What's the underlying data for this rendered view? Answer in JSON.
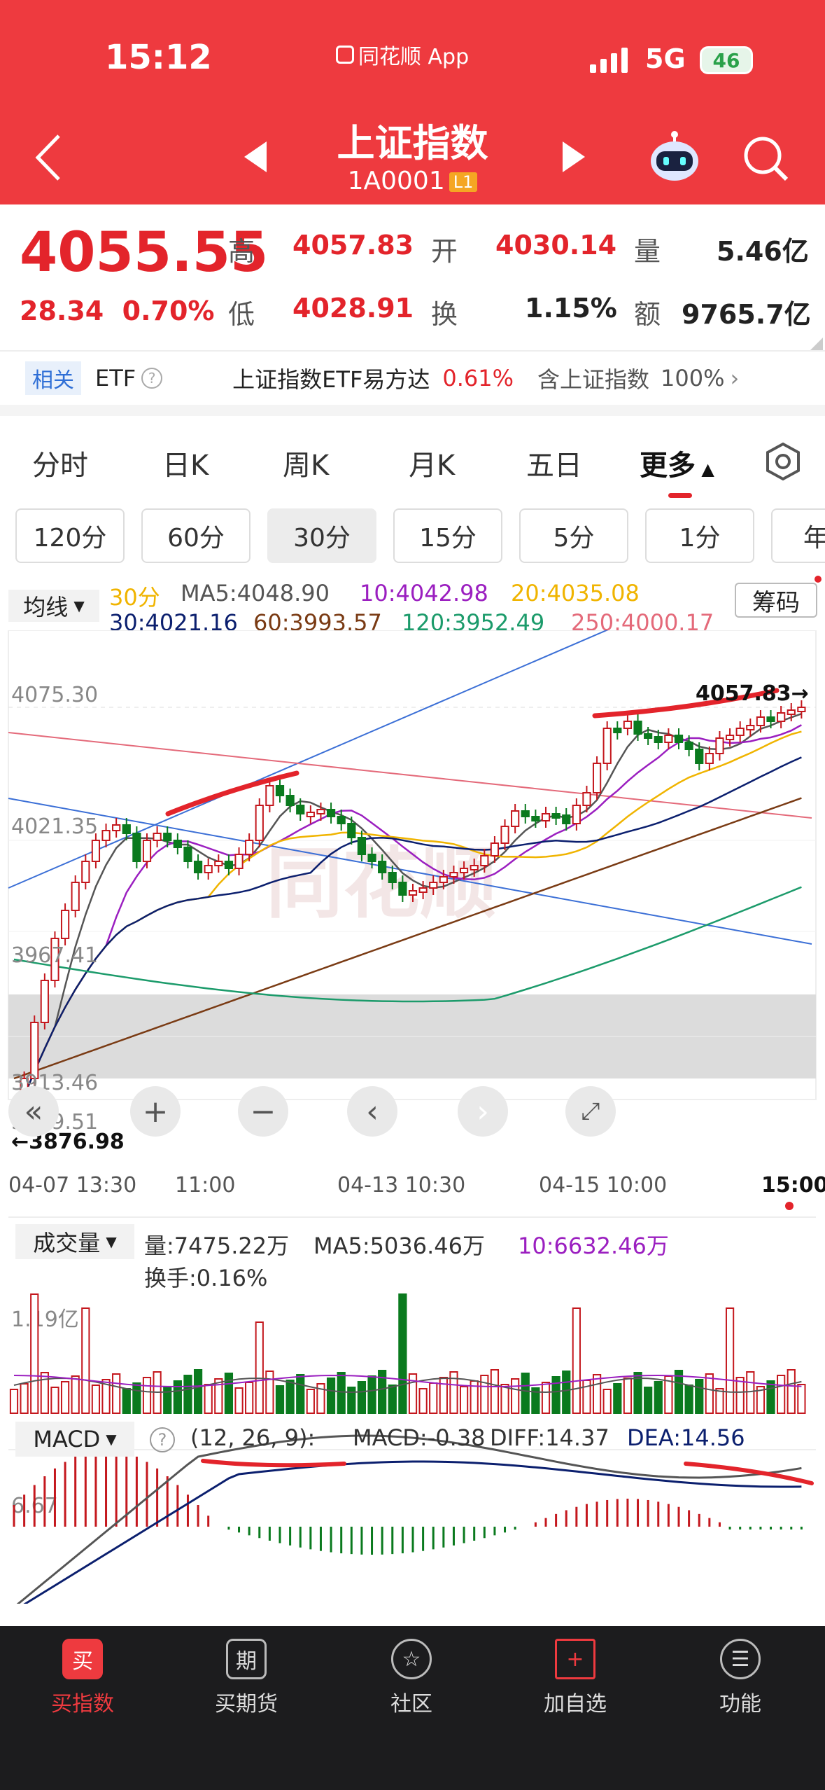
{
  "status": {
    "time": "15:12",
    "app_name": "同花顺 App",
    "network": "5G",
    "battery": "46"
  },
  "header": {
    "title": "上证指数",
    "code": "1A0001",
    "level": "L1"
  },
  "quote": {
    "price": "4055.55",
    "change": "28.34",
    "change_pct": "0.70%",
    "high_label": "高",
    "high": "4057.83",
    "low_label": "低",
    "low": "4028.91",
    "open_label": "开",
    "open": "4030.14",
    "turnover_label": "换",
    "turnover": "1.15%",
    "volume_label": "量",
    "volume": "5.46亿",
    "amount_label": "额",
    "amount": "9765.7亿"
  },
  "etf": {
    "tag": "相关",
    "label": "ETF",
    "name": "上证指数ETF易方达",
    "change": "0.61%",
    "contain": "含上证指数",
    "weight": "100%"
  },
  "tabs": [
    "分时",
    "日K",
    "周K",
    "月K",
    "五日",
    "更多"
  ],
  "periods": [
    "120分",
    "60分",
    "30分",
    "15分",
    "5分",
    "1分",
    "年"
  ],
  "chart": {
    "ma_button": "均线",
    "chips_button": "筹码",
    "period": "30分",
    "ma5": "MA5:4048.90",
    "ma10": "10:4042.98",
    "ma20": "20:4035.08",
    "ma30": "30:4021.16",
    "ma60": "60:3993.57",
    "ma120": "120:3952.49",
    "ma250": "250:4000.17",
    "y_labels": [
      "4075.30",
      "4021.35",
      "3967.41",
      "3913.46",
      "3859.51"
    ],
    "high_marker": "4057.83→",
    "low_marker": "←3876.98",
    "x_labels": [
      "04-07 13:30",
      "11:00",
      "04-13 10:30",
      "04-15 10:00",
      "15:00"
    ],
    "watermark": "同花顺"
  },
  "volume": {
    "button": "成交量",
    "vol": "量:7475.22万",
    "ma5": "MA5:5036.46万",
    "ma10": "10:6632.46万",
    "turnover": "换手:0.16%",
    "y_label": "1.19亿"
  },
  "macd": {
    "button": "MACD",
    "params": "(12, 26, 9):",
    "macd": "MACD:-0.38",
    "diff": "DIFF:14.37",
    "dea": "DEA:14.56",
    "y_label": "6.67"
  },
  "nav": [
    {
      "icon": "买",
      "label": "买指数"
    },
    {
      "icon": "期",
      "label": "买期货"
    },
    {
      "icon": "☆",
      "label": "社区"
    },
    {
      "icon": "+",
      "label": "加自选"
    },
    {
      "icon": "☰",
      "label": "功能"
    }
  ],
  "colors": {
    "brand": "#ee3a3f",
    "up": "#c4171d",
    "down": "#0a7a1e",
    "ma5": "#555555",
    "ma10": "#9b1fc0",
    "ma20": "#f0b400",
    "ma30": "#0b1f6e",
    "ma60": "#7a3b14",
    "ma120": "#1c9b6b",
    "ma250": "#e46a7a"
  }
}
